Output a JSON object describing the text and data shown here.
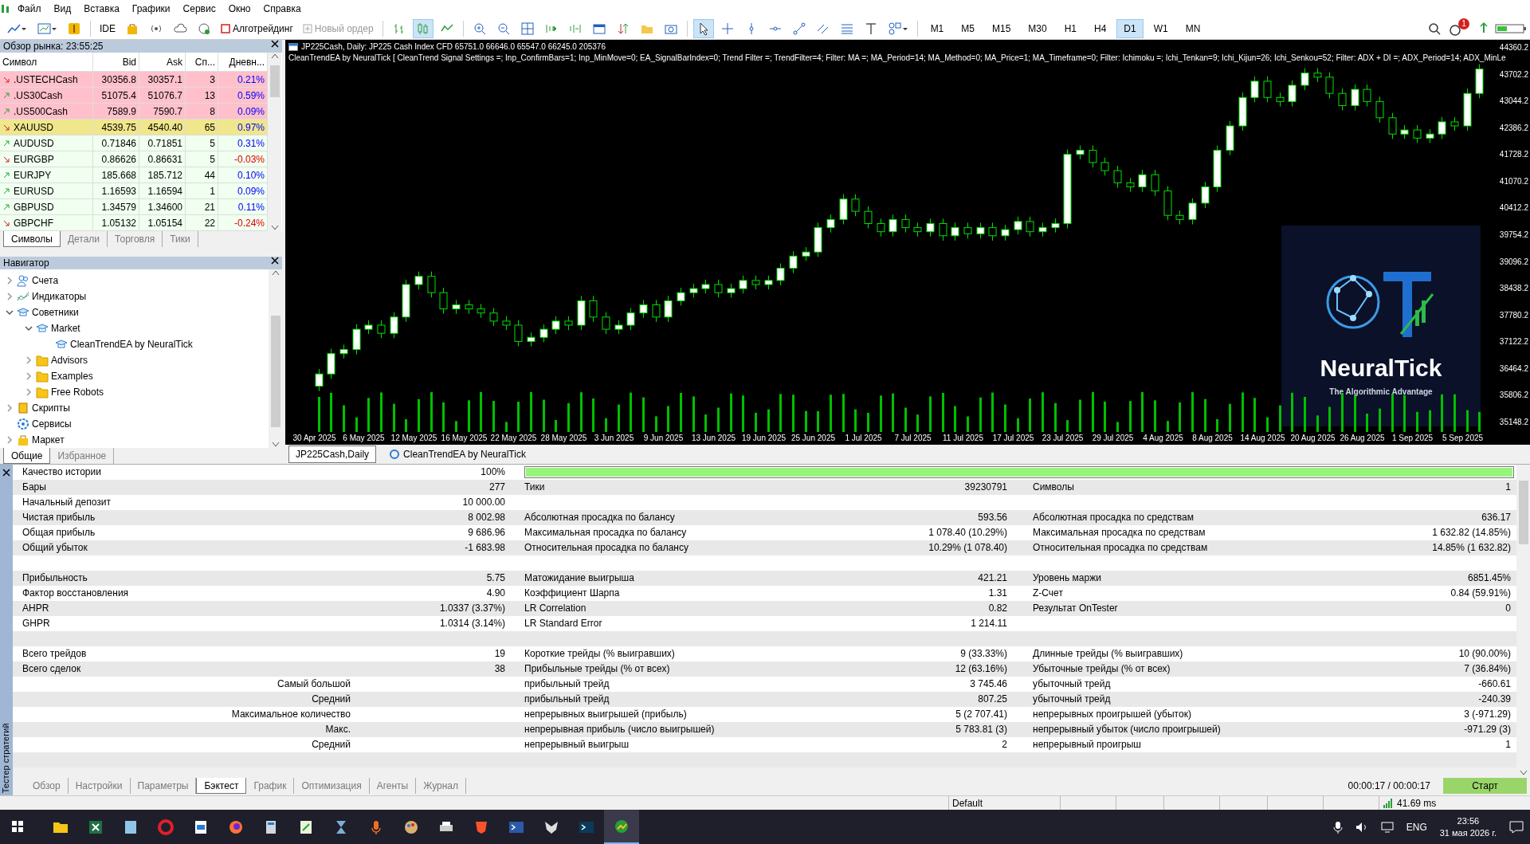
{
  "menu": [
    "Файл",
    "Вид",
    "Вставка",
    "Графики",
    "Сервис",
    "Окно",
    "Справка"
  ],
  "toolbar": [
    {
      "kind": "linechart"
    },
    {
      "kind": "chartmenu"
    },
    {
      "kind": "dollar"
    },
    {
      "kind": "text",
      "label": "IDE"
    },
    {
      "kind": "bag"
    },
    {
      "kind": "radio"
    },
    {
      "kind": "cloud"
    },
    {
      "kind": "vps"
    },
    {
      "kind": "algo",
      "label": "Алготрейдинг"
    },
    {
      "kind": "order",
      "label": "Новый ордер",
      "disabled": true
    },
    {
      "kind": "bars",
      "selected": false
    },
    {
      "kind": "candles",
      "selected": true
    },
    {
      "kind": "line",
      "selected": false
    },
    {
      "kind": "zoomin"
    },
    {
      "kind": "zoomout"
    },
    {
      "kind": "grid"
    },
    {
      "kind": "scroll"
    },
    {
      "kind": "shift"
    },
    {
      "kind": "window"
    },
    {
      "kind": "updown"
    },
    {
      "kind": "folder"
    },
    {
      "kind": "camera"
    },
    {
      "kind": "cursor",
      "selected": true
    },
    {
      "kind": "crosshair",
      "selected": false
    },
    {
      "kind": "vline"
    },
    {
      "kind": "hline"
    },
    {
      "kind": "trend"
    },
    {
      "kind": "channel"
    },
    {
      "kind": "fibo"
    },
    {
      "kind": "textt"
    },
    {
      "kind": "shapes"
    }
  ],
  "timeframes": [
    {
      "label": "M1",
      "selected": false
    },
    {
      "label": "M5",
      "selected": false
    },
    {
      "label": "M15",
      "selected": false
    },
    {
      "label": "M30",
      "selected": false
    },
    {
      "label": "H1",
      "selected": false
    },
    {
      "label": "H4",
      "selected": false
    },
    {
      "label": "D1",
      "selected": true
    },
    {
      "label": "W1",
      "selected": false
    },
    {
      "label": "MN",
      "selected": false
    }
  ],
  "notifications": "1",
  "market_watch": {
    "title": "Обзор рынка: 23:55:25",
    "columns": [
      "Символ",
      "Bid",
      "Ask",
      "Сп...",
      "Дневн..."
    ],
    "rows": [
      {
        "symbol": ".USTECHCash",
        "bid": "30356.8",
        "ask": "30357.1",
        "spread": "3",
        "daily": "0.21%",
        "rising": false,
        "negative": false,
        "color": "#ffc0cb"
      },
      {
        "symbol": ".US30Cash",
        "bid": "51075.4",
        "ask": "51076.7",
        "spread": "13",
        "daily": "0.59%",
        "rising": true,
        "negative": false,
        "color": "#ffc0cb"
      },
      {
        "symbol": ".US500Cash",
        "bid": "7589.9",
        "ask": "7590.7",
        "spread": "8",
        "daily": "0.09%",
        "rising": true,
        "negative": false,
        "color": "#ffc0cb"
      },
      {
        "symbol": "XAUUSD",
        "bid": "4539.75",
        "ask": "4540.40",
        "spread": "65",
        "daily": "0.97%",
        "rising": false,
        "negative": false,
        "color": "#f0e68c"
      },
      {
        "symbol": "AUDUSD",
        "bid": "0.71846",
        "ask": "0.71851",
        "spread": "5",
        "daily": "0.31%",
        "rising": true,
        "negative": false,
        "color": "#f0fff0"
      },
      {
        "symbol": "EURGBP",
        "bid": "0.86626",
        "ask": "0.86631",
        "spread": "5",
        "daily": "-0.03%",
        "rising": false,
        "negative": true,
        "color": "#f0fff0"
      },
      {
        "symbol": "EURJPY",
        "bid": "185.668",
        "ask": "185.712",
        "spread": "44",
        "daily": "0.10%",
        "rising": true,
        "negative": false,
        "color": "#f0fff0"
      },
      {
        "symbol": "EURUSD",
        "bid": "1.16593",
        "ask": "1.16594",
        "spread": "1",
        "daily": "0.09%",
        "rising": true,
        "negative": false,
        "color": "#f0fff0"
      },
      {
        "symbol": "GBPUSD",
        "bid": "1.34579",
        "ask": "1.34600",
        "spread": "21",
        "daily": "0.11%",
        "rising": true,
        "negative": false,
        "color": "#f0fff0"
      },
      {
        "symbol": "GBPCHF",
        "bid": "1.05132",
        "ask": "1.05154",
        "spread": "22",
        "daily": "-0.24%",
        "rising": false,
        "negative": true,
        "color": "#f0fff0"
      }
    ],
    "tabs": [
      {
        "label": "Символы",
        "selected": true
      },
      {
        "label": "Детали",
        "selected": false
      },
      {
        "label": "Торговля",
        "selected": false
      },
      {
        "label": "Тики",
        "selected": false
      }
    ]
  },
  "navigator": {
    "title": "Навигатор",
    "tree": [
      {
        "label": "Счета",
        "kind": "accounts",
        "expanded": false
      },
      {
        "label": "Индикаторы",
        "kind": "indicators",
        "expanded": false
      },
      {
        "label": "Советники",
        "kind": "experts",
        "expanded": true,
        "children": [
          {
            "label": "Market",
            "kind": "experts",
            "expanded": true,
            "children": [
              {
                "label": "CleanTrendEA by NeuralTick",
                "kind": "experts"
              }
            ]
          },
          {
            "label": "Advisors",
            "kind": "folder",
            "expanded": false
          },
          {
            "label": "Examples",
            "kind": "folder",
            "expanded": false
          },
          {
            "label": "Free Robots",
            "kind": "folder",
            "expanded": false
          }
        ]
      },
      {
        "label": "Скрипты",
        "kind": "scripts",
        "expanded": false
      },
      {
        "label": "Сервисы",
        "kind": "services"
      },
      {
        "label": "Маркет",
        "kind": "market",
        "expanded": false
      }
    ],
    "tabs": [
      {
        "label": "Общие",
        "selected": true
      },
      {
        "label": "Избранное",
        "selected": false
      }
    ]
  },
  "chart": {
    "header": "JP225Cash, Daily:  JP225 Cash Index CFD  65751.0 66646.0 65547.0 66245.0  205376",
    "ea_line": "CleanTrendEA by NeuralTick [ CleanTrend Signal Settings =; Inp_ConfirmBars=1; Inp_MinMove=0; EA_SignalBarIndex=0;  Trend Filter =; TrendFilter=4;  Filter: MA =; MA_Period=14; MA_Method=0; MA_Price=1; MA_Timeframe=0;  Filter: Ichimoku =; Ichi_Tenkan=9; Ichi_Kijun=26; Ichi_Senkou=52;  Filter: ADX + DI =; ADX_Period=14; ADX_MinLe",
    "chart_data": {
      "type": "candlestick",
      "yticks": [
        {
          "value": 44360.2,
          "label": "44360.2"
        },
        {
          "value": 43702.2,
          "label": "43702.2"
        },
        {
          "value": 43044.2,
          "label": "43044.2"
        },
        {
          "value": 42386.2,
          "label": "42386.2"
        },
        {
          "value": 41728.2,
          "label": "41728.2"
        },
        {
          "value": 41070.2,
          "label": "41070.2"
        },
        {
          "value": 40412.2,
          "label": "40412.2"
        },
        {
          "value": 39754.2,
          "label": "39754.2"
        },
        {
          "value": 39096.2,
          "label": "39096.2"
        },
        {
          "value": 38438.2,
          "label": "38438.2"
        },
        {
          "value": 37780.2,
          "label": "37780.2"
        },
        {
          "value": 37122.2,
          "label": "37122.2"
        },
        {
          "value": 36464.2,
          "label": "36464.2"
        },
        {
          "value": 35806.2,
          "label": "35806.2"
        },
        {
          "value": 35148.2,
          "label": "35148.2"
        }
      ],
      "categories": [
        "30 Apr 2025",
        null,
        null,
        null,
        "6 May 2025",
        null,
        null,
        null,
        "12 May 2025",
        null,
        null,
        null,
        "16 May 2025",
        null,
        null,
        null,
        "22 May 2025",
        null,
        null,
        null,
        "28 May 2025",
        null,
        null,
        null,
        "3 Jun 2025",
        null,
        null,
        null,
        "9 Jun 2025",
        null,
        null,
        null,
        "13 Jun 2025",
        null,
        null,
        null,
        "19 Jun 2025",
        null,
        null,
        null,
        "25 Jun 2025",
        null,
        null,
        null,
        "1 Jul 2025",
        null,
        null,
        null,
        "7 Jul 2025",
        null,
        null,
        null,
        "11 Jul 2025",
        null,
        null,
        null,
        "17 Jul 2025",
        null,
        null,
        null,
        "23 Jul 2025",
        null,
        null,
        null,
        "29 Jul 2025",
        null,
        null,
        null,
        "4 Aug 2025",
        null,
        null,
        null,
        "8 Aug 2025",
        null,
        null,
        null,
        "14 Aug 2025",
        null,
        null,
        null,
        "20 Aug 2025",
        null,
        null,
        null,
        "26 Aug 2025",
        null,
        null,
        null,
        "1 Sep 2025",
        null,
        null,
        null,
        "5 Sep 2025",
        null
      ],
      "ylim": [
        35148.2,
        44360.2
      ],
      "ohlc": [
        [
          36000,
          36420,
          35880,
          36300
        ],
        [
          36300,
          36920,
          36180,
          36800
        ],
        [
          36800,
          37020,
          36680,
          36900
        ],
        [
          36900,
          37520,
          36780,
          37400
        ],
        [
          37400,
          37620,
          37280,
          37500
        ],
        [
          37500,
          37620,
          37180,
          37300
        ],
        [
          37300,
          37820,
          37180,
          37700
        ],
        [
          37700,
          38620,
          37580,
          38500
        ],
        [
          38500,
          38820,
          38380,
          38700
        ],
        [
          38700,
          38820,
          38180,
          38300
        ],
        [
          38300,
          38420,
          37780,
          37900
        ],
        [
          37900,
          38120,
          37780,
          38000
        ],
        [
          38000,
          38120,
          37780,
          37900
        ],
        [
          37900,
          38020,
          37680,
          37800
        ],
        [
          37800,
          37920,
          37480,
          37600
        ],
        [
          37600,
          37720,
          37380,
          37500
        ],
        [
          37500,
          37620,
          36980,
          37100
        ],
        [
          37100,
          37320,
          36980,
          37200
        ],
        [
          37200,
          37520,
          37080,
          37400
        ],
        [
          37400,
          37720,
          37280,
          37600
        ],
        [
          37600,
          37720,
          37380,
          37500
        ],
        [
          37500,
          38220,
          37380,
          38100
        ],
        [
          38100,
          38220,
          37580,
          37700
        ],
        [
          37700,
          37820,
          37280,
          37400
        ],
        [
          37400,
          37620,
          37280,
          37500
        ],
        [
          37500,
          37920,
          37380,
          37800
        ],
        [
          37800,
          38120,
          37680,
          38000
        ],
        [
          38000,
          38120,
          37580,
          37700
        ],
        [
          37700,
          38220,
          37580,
          38100
        ],
        [
          38100,
          38420,
          37980,
          38300
        ],
        [
          38300,
          38520,
          38180,
          38400
        ],
        [
          38400,
          38620,
          38280,
          38500
        ],
        [
          38500,
          38620,
          38180,
          38300
        ],
        [
          38300,
          38520,
          38180,
          38400
        ],
        [
          38400,
          38720,
          38280,
          38600
        ],
        [
          38600,
          38720,
          38380,
          38500
        ],
        [
          38500,
          38720,
          38380,
          38600
        ],
        [
          38600,
          39020,
          38480,
          38900
        ],
        [
          38900,
          39320,
          38780,
          39200
        ],
        [
          39200,
          39420,
          39080,
          39300
        ],
        [
          39300,
          40020,
          39180,
          39900
        ],
        [
          39900,
          40220,
          39780,
          40100
        ],
        [
          40100,
          40720,
          39980,
          40600
        ],
        [
          40600,
          40720,
          40180,
          40300
        ],
        [
          40300,
          40420,
          39880,
          40000
        ],
        [
          40000,
          40120,
          39680,
          39800
        ],
        [
          39800,
          40220,
          39680,
          40100
        ],
        [
          40100,
          40220,
          39780,
          39900
        ],
        [
          39900,
          40020,
          39680,
          39800
        ],
        [
          39800,
          40120,
          39680,
          40000
        ],
        [
          40000,
          40120,
          39580,
          39700
        ],
        [
          39700,
          40020,
          39580,
          39900
        ],
        [
          39900,
          40020,
          39630,
          39750
        ],
        [
          39750,
          40020,
          39630,
          39900
        ],
        [
          39900,
          40020,
          39580,
          39700
        ],
        [
          39700,
          39970,
          39580,
          39850
        ],
        [
          39850,
          40170,
          39730,
          40050
        ],
        [
          40050,
          40170,
          39680,
          39800
        ],
        [
          39800,
          40020,
          39680,
          39900
        ],
        [
          39900,
          40120,
          39780,
          40000
        ],
        [
          40000,
          41820,
          39880,
          41700
        ],
        [
          41700,
          41920,
          41580,
          41800
        ],
        [
          41800,
          41920,
          41380,
          41500
        ],
        [
          41500,
          41620,
          41180,
          41300
        ],
        [
          41300,
          41420,
          40880,
          41000
        ],
        [
          41000,
          41120,
          40780,
          40900
        ],
        [
          40900,
          41320,
          40780,
          41200
        ],
        [
          41200,
          41320,
          40680,
          40800
        ],
        [
          40800,
          40920,
          40080,
          40200
        ],
        [
          40200,
          40320,
          39980,
          40100
        ],
        [
          40100,
          40620,
          39980,
          40500
        ],
        [
          40500,
          41020,
          40380,
          40900
        ],
        [
          40900,
          41920,
          40780,
          41800
        ],
        [
          41800,
          42520,
          41680,
          42400
        ],
        [
          42400,
          43220,
          42280,
          43100
        ],
        [
          43100,
          43620,
          42980,
          43500
        ],
        [
          43500,
          43620,
          42980,
          43100
        ],
        [
          43100,
          43220,
          42880,
          43000
        ],
        [
          43000,
          43520,
          42880,
          43400
        ],
        [
          43400,
          43820,
          43280,
          43700
        ],
        [
          43700,
          43820,
          43480,
          43600
        ],
        [
          43600,
          43720,
          43080,
          43200
        ],
        [
          43200,
          43320,
          42780,
          42900
        ],
        [
          42900,
          43420,
          42780,
          43300
        ],
        [
          43300,
          43420,
          42880,
          43000
        ],
        [
          43000,
          43120,
          42480,
          42600
        ],
        [
          42600,
          42720,
          42080,
          42200
        ],
        [
          42200,
          42420,
          42080,
          42300
        ],
        [
          42300,
          42420,
          41980,
          42100
        ],
        [
          42100,
          42320,
          41980,
          42200
        ],
        [
          42200,
          42620,
          42080,
          42500
        ],
        [
          42500,
          42620,
          42280,
          42400
        ],
        [
          42400,
          43320,
          42280,
          43200
        ],
        [
          43200,
          43920,
          43080,
          43800
        ]
      ]
    },
    "logo": {
      "name": "NeuralTick",
      "tagline": "The Algorithmic Advantage"
    },
    "tabs": [
      {
        "label": "JP225Cash,Daily",
        "selected": true
      },
      {
        "label": "CleanTrendEA by NeuralTick",
        "selected": false
      }
    ]
  },
  "tester": {
    "side_title": "Тестер стратегий",
    "rows": [
      {
        "kind": "quality",
        "label_1": "Качество истории",
        "value_1": "100%",
        "level": 1
      },
      {
        "kind": "stat",
        "label_1": "Бары",
        "value_1": "277",
        "label_2": "Тики",
        "value_2": "39230791",
        "label_3": "Символы",
        "value_3": "1"
      },
      {
        "kind": "stat",
        "label_1": "Начальный депозит",
        "value_1": "10 000.00"
      },
      {
        "kind": "stat",
        "label_1": "Чистая прибыль",
        "value_1": "8 002.98",
        "label_2": "Абсолютная просадка по балансу",
        "value_2": "593.56",
        "label_3": "Абсолютная просадка по средствам",
        "value_3": "636.17"
      },
      {
        "kind": "stat",
        "label_1": "Общая прибыль",
        "value_1": "9 686.96",
        "label_2": "Максимальная просадка по балансу",
        "value_2": "1 078.40 (10.29%)",
        "label_3": "Максимальная просадка по средствам",
        "value_3": "1 632.82 (14.85%)"
      },
      {
        "kind": "stat",
        "label_1": "Общий убыток",
        "value_1": "-1 683.98",
        "label_2": "Относительная просадка по балансу",
        "value_2": "10.29% (1 078.40)",
        "label_3": "Относительная просадка по средствам",
        "value_3": "14.85% (1 632.82)"
      },
      {
        "kind": "blank"
      },
      {
        "kind": "stat",
        "label_1": "Прибыльность",
        "value_1": "5.75",
        "label_2": "Матожидание выигрыша",
        "value_2": "421.21",
        "label_3": "Уровень маржи",
        "value_3": "6851.45%"
      },
      {
        "kind": "stat",
        "label_1": "Фактор восстановления",
        "value_1": "4.90",
        "label_2": "Коэффициент Шарпа",
        "value_2": "1.31",
        "label_3": "Z-Счет",
        "value_3": "0.84 (59.91%)"
      },
      {
        "kind": "stat",
        "label_1": "AHPR",
        "value_1": "1.0337 (3.37%)",
        "label_2": "LR Correlation",
        "value_2": "0.82",
        "label_3": "Результат OnTester",
        "value_3": "0"
      },
      {
        "kind": "stat",
        "label_1": "GHPR",
        "value_1": "1.0314 (3.14%)",
        "label_2": "LR Standard Error",
        "value_2": "1 214.11"
      },
      {
        "kind": "blank"
      },
      {
        "kind": "stat",
        "label_1": "Всего трейдов",
        "value_1": "19",
        "label_2": "Короткие трейды (% выигравших)",
        "value_2": "9 (33.33%)",
        "label_3": "Длинные трейды (% выигравших)",
        "value_3": "10 (90.00%)"
      },
      {
        "kind": "stat",
        "label_1": "Всего сделок",
        "value_1": "38",
        "label_2": "Прибыльные трейды (% от всех)",
        "value_2": "12 (63.16%)",
        "label_3": "Убыточные трейды (% от всех)",
        "value_3": "7 (36.84%)"
      },
      {
        "kind": "detail",
        "label_1": "Самый большой",
        "label_2": "прибыльный трейд",
        "value_2": "3 745.46",
        "label_3": "убыточный трейд",
        "value_3": "-660.61"
      },
      {
        "kind": "detail",
        "label_1": "Средний",
        "label_2": "прибыльный трейд",
        "value_2": "807.25",
        "label_3": "убыточный трейд",
        "value_3": "-240.39"
      },
      {
        "kind": "detail",
        "label_1": "Максимальное количество",
        "label_2": "непрерывных выигрышей (прибыль)",
        "value_2": "5 (2 707.41)",
        "label_3": "непрерывных проигрышей (убыток)",
        "value_3": "3 (-971.29)"
      },
      {
        "kind": "detail",
        "label_1": "Макс.",
        "label_2": "непрерывная прибыль (число выигрышей)",
        "value_2": "5 783.81 (3)",
        "label_3": "непрерывный убыток (число проигрышей)",
        "value_3": "-971.29 (3)"
      },
      {
        "kind": "detail",
        "label_1": "Средний",
        "label_2": "непрерывный выигрыш",
        "value_2": "2",
        "label_3": "непрерывный проигрыш",
        "value_3": "1"
      },
      {
        "kind": "blank"
      }
    ],
    "tabs": [
      {
        "label": "Обзор",
        "selected": false
      },
      {
        "label": "Настройки",
        "selected": false
      },
      {
        "label": "Параметры",
        "selected": false
      },
      {
        "label": "Бэктест",
        "selected": true
      },
      {
        "label": "График",
        "selected": false
      },
      {
        "label": "Оптимизация",
        "selected": false
      },
      {
        "label": "Агенты",
        "selected": false
      },
      {
        "label": "Журнал",
        "selected": false
      }
    ],
    "elapsed": "00:00:17 / 00:00:17",
    "start": "Старт"
  },
  "status_bar": {
    "profile": "Default",
    "ping": "41.69 ms"
  },
  "taskbar": {
    "apps": [
      {
        "kind": "explorer",
        "active": false
      },
      {
        "kind": "excel",
        "active": false
      },
      {
        "kind": "notepad",
        "active": false
      },
      {
        "kind": "opera",
        "active": false
      },
      {
        "kind": "paint",
        "active": false
      },
      {
        "kind": "firefox",
        "active": false
      },
      {
        "kind": "calc",
        "active": false
      },
      {
        "kind": "editor",
        "active": false
      },
      {
        "kind": "hourglass",
        "active": false
      },
      {
        "kind": "mic",
        "active": false
      },
      {
        "kind": "palette",
        "active": false
      },
      {
        "kind": "printer",
        "active": false
      },
      {
        "kind": "brave",
        "active": false
      },
      {
        "kind": "powershell",
        "active": false
      },
      {
        "kind": "fox",
        "active": false
      },
      {
        "kind": "terminal",
        "active": false
      },
      {
        "kind": "mt5",
        "active": true
      }
    ],
    "language": "ENG",
    "time": "23:56",
    "date": "31 мая 2026 г."
  }
}
